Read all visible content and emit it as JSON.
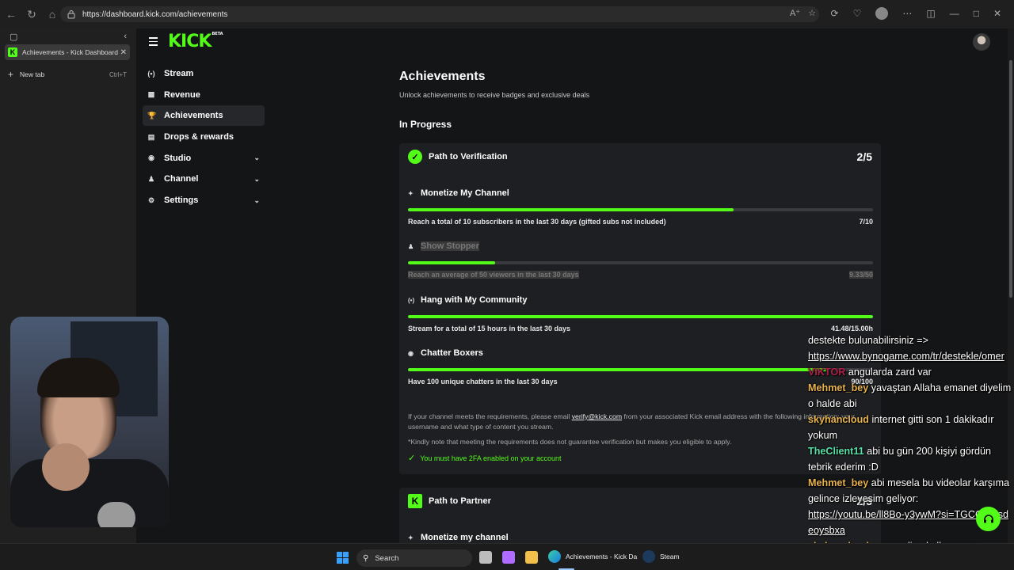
{
  "browser": {
    "url": "https://dashboard.kick.com/achievements",
    "tabs": [
      {
        "title": "Achievements - Kick Dashboard",
        "active": true
      },
      {
        "title": "New tab",
        "shortcut": "Ctrl+T"
      }
    ]
  },
  "app": {
    "logo": "KICK",
    "logo_tag": "BETA",
    "accent": "#53fc18"
  },
  "sidebar": {
    "items": [
      {
        "label": "Stream",
        "icon": "broadcast-icon"
      },
      {
        "label": "Revenue",
        "icon": "revenue-icon"
      },
      {
        "label": "Achievements",
        "icon": "trophy-icon",
        "active": true
      },
      {
        "label": "Drops & rewards",
        "icon": "gift-icon"
      },
      {
        "label": "Studio",
        "icon": "studio-icon"
      },
      {
        "label": "Channel",
        "icon": "channel-icon"
      },
      {
        "label": "Settings",
        "icon": "gear-icon"
      }
    ]
  },
  "page": {
    "title": "Achievements",
    "subtitle": "Unlock achievements to receive badges and exclusive deals",
    "section": "In Progress"
  },
  "verification": {
    "title": "Path to Verification",
    "count": "2/5",
    "achievements": [
      {
        "title": "Monetize My Channel",
        "desc": "Reach a total of 10 subscribers in the last 30 days (gifted subs not included)",
        "value": "7/10",
        "progress": 0.7
      },
      {
        "title": "Show Stopper",
        "desc": "Reach an average of 50 viewers in the last 30 days",
        "value": "9.33/50",
        "progress": 0.187
      },
      {
        "title": "Hang with My Community",
        "desc": "Stream for a total of 15 hours in the last 30 days",
        "value": "41.48/15.00h",
        "progress": 1.0
      },
      {
        "title": "Chatter Boxers",
        "desc": "Have 100 unique chatters in the last 30 days",
        "value": "90/100",
        "progress": 0.9
      }
    ],
    "note_prefix": "If your channel meets the requirements, please email",
    "note_email": "verify@kick.com",
    "note_suffix": "from your associated Kick email address with the following information: your username and what type of content you stream.",
    "disclaimer": "*Kindly note that meeting the requirements does not guarantee verification but makes you eligible to apply.",
    "twofa": "You must have 2FA enabled on your account"
  },
  "partner": {
    "title": "Path to Partner",
    "count": "2/5",
    "first_achievement": "Monetize my channel"
  },
  "chat": [
    {
      "user": "",
      "text": "destekte bulunabilirsiniz =>"
    },
    {
      "user": "",
      "url": "https://www.bynogame.com/tr/destekle/omer"
    },
    {
      "user": "VIKTOR",
      "color": "#b0204a",
      "text": "angularda zard var"
    },
    {
      "user": "Mehmet_bey",
      "color": "#e8b24c",
      "text": "yavaştan Allaha emanet diyelim o halde abi"
    },
    {
      "user": "skyhancloud",
      "color": "#e8b24c",
      "text": "internet gitti son 1 dakikadır yokum"
    },
    {
      "user": "TheClient11",
      "color": "#58e0a8",
      "text": "abi bu gün 200 kişiyi gördün tebrik ederim :D"
    },
    {
      "user": "Mehmet_bey",
      "color": "#e8b24c",
      "text": "abi mesela bu videolar karşıma gelince izleyesim geliyor:"
    },
    {
      "user": "",
      "url": "https://youtu.be/ll8Bo-y3ywM?si=TGCQhClsdeoysbxa"
    },
    {
      "user": "skyhancloud",
      "color": "#e8b24c",
      "text": "superonline kullanmayın kullandırtmayın"
    }
  ],
  "taskbar": {
    "search": "Search",
    "apps": [
      {
        "label": "Achievements - Kick Da",
        "icon": "edge-icon"
      },
      {
        "label": "Steam",
        "icon": "steam-icon"
      }
    ]
  }
}
